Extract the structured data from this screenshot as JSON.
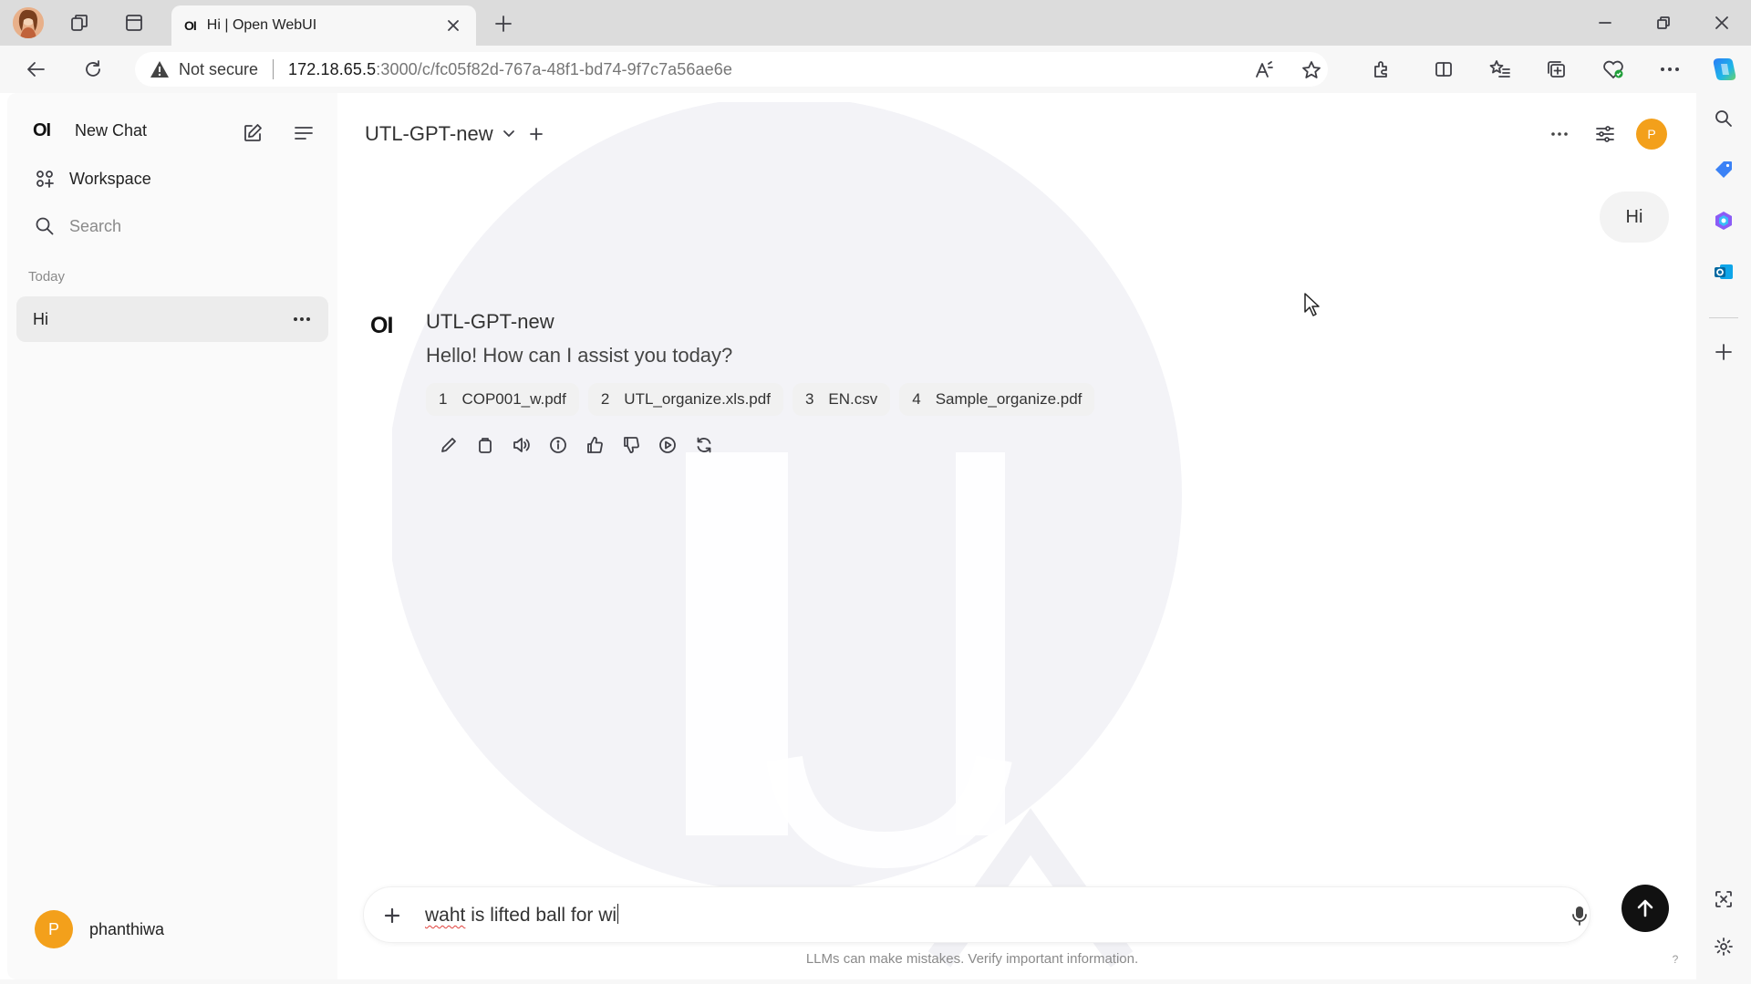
{
  "browser": {
    "tab_title": "Hi | Open WebUI",
    "tab_favicon": "OI",
    "address": {
      "security_label": "Not secure",
      "url_host": "172.18.65.5",
      "url_path": ":3000/c/fc05f82d-767a-48f1-bd74-9f7c7a56ae6e"
    }
  },
  "sidebar": {
    "logo": "OI",
    "new_chat": "New Chat",
    "workspace": "Workspace",
    "search_placeholder": "Search",
    "section_today": "Today",
    "chats": [
      {
        "title": "Hi"
      }
    ],
    "user": {
      "initial": "P",
      "name": "phanthiwa"
    }
  },
  "header": {
    "model_name": "UTL-GPT-new",
    "avatar_initial": "P"
  },
  "messages": {
    "user": "Hi",
    "assistant": {
      "logo": "OI",
      "name": "UTL-GPT-new",
      "text": "Hello! How can I assist you today?",
      "citations": [
        {
          "num": "1",
          "file": "COP001_w.pdf"
        },
        {
          "num": "2",
          "file": "UTL_organize.xls.pdf"
        },
        {
          "num": "3",
          "file": "EN.csv"
        },
        {
          "num": "4",
          "file": "Sample_organize.pdf"
        }
      ]
    }
  },
  "input": {
    "typed_misspelled": "waht",
    "typed_rest": " is lifted ball for wi"
  },
  "footer": {
    "disclaimer": "LLMs can make mistakes. Verify important information.",
    "help": "?"
  },
  "colors": {
    "accent_avatar": "#f3a01b",
    "send_button": "#111111",
    "selected_chat": "#ececec",
    "browser_frame": "#dcdcdc"
  },
  "icons": [
    "workspaces-icon",
    "tab-actions-icon",
    "vertical-tabs-icon",
    "back-icon",
    "refresh-icon",
    "warning-icon",
    "read-aloud-icon",
    "favorite-star-icon",
    "extensions-icon",
    "split-screen-icon",
    "favorites-icon",
    "collections-icon",
    "browser-essentials-icon",
    "more-icon",
    "copilot-icon",
    "compose-icon",
    "menu-icon",
    "workspace-grid-icon",
    "search-icon",
    "chevron-down-icon",
    "plus-icon",
    "sliders-icon",
    "pencil-icon",
    "copy-icon",
    "speaker-icon",
    "info-icon",
    "thumbs-up-icon",
    "thumbs-down-icon",
    "play-icon",
    "regenerate-icon",
    "microphone-icon",
    "arrow-up-icon"
  ]
}
